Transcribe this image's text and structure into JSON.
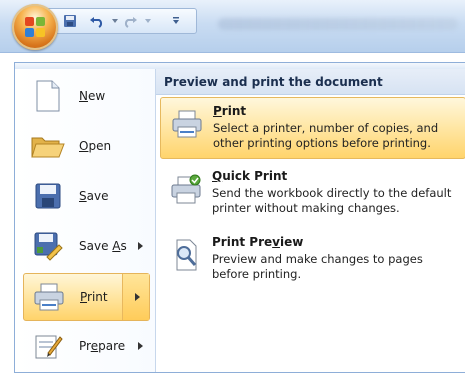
{
  "left_menu": {
    "items": [
      {
        "label_pre": "",
        "label_u": "N",
        "label_post": "ew",
        "icon": "new-document-icon",
        "submenu": false
      },
      {
        "label_pre": "",
        "label_u": "O",
        "label_post": "pen",
        "icon": "open-folder-icon",
        "submenu": false
      },
      {
        "label_pre": "",
        "label_u": "S",
        "label_post": "ave",
        "icon": "save-disk-icon",
        "submenu": false
      },
      {
        "label_pre": "Save ",
        "label_u": "A",
        "label_post": "s",
        "icon": "save-as-icon",
        "submenu": true
      },
      {
        "label_pre": "",
        "label_u": "P",
        "label_post": "rint",
        "icon": "printer-icon",
        "submenu": true,
        "selected": true
      },
      {
        "label_pre": "Pr",
        "label_u": "e",
        "label_post": "pare",
        "icon": "prepare-icon",
        "submenu": true
      }
    ]
  },
  "submenu": {
    "heading": "Preview and print the document",
    "options": [
      {
        "title_pre": "",
        "title_u": "P",
        "title_post": "rint",
        "desc": "Select a printer, number of copies, and other printing options before printing.",
        "icon": "printer-icon",
        "selected": true
      },
      {
        "title_pre": "",
        "title_u": "Q",
        "title_post": "uick Print",
        "desc": "Send the workbook directly to the default printer without making changes.",
        "icon": "quick-print-icon"
      },
      {
        "title_pre": "Print Pre",
        "title_u": "v",
        "title_post": "iew",
        "desc": "Preview and make changes to pages before printing.",
        "icon": "print-preview-icon"
      }
    ]
  },
  "colors": {
    "accent_highlight": "#ffd46c",
    "menu_border": "#8eaed8",
    "ribbon_blue": "#c9dcf2"
  }
}
